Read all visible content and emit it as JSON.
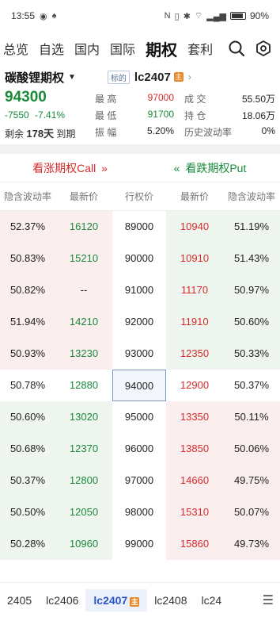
{
  "status": {
    "time": "13:55",
    "battery": "90%",
    "signal": "5G"
  },
  "nav": {
    "tabs": [
      "总览",
      "自选",
      "国内",
      "国际",
      "期权",
      "套利"
    ],
    "active_index": 4,
    "search_icon": "search-icon",
    "settings_icon": "hexagon-settings-icon"
  },
  "product": {
    "name": "碳酸锂期权",
    "underlying_tag": "标的",
    "contract": "lc2407",
    "main_badge": "主"
  },
  "quote": {
    "price": "94300",
    "change": "-7550",
    "change_pct": "-7.41%",
    "remain_prefix": "剩余",
    "remain_days": "178天",
    "remain_suffix": "到期",
    "high_label": "最 高",
    "high": "97000",
    "low_label": "最 低",
    "low": "91700",
    "amp_label": "振 幅",
    "amp": "5.20%",
    "volume_label": "成 交",
    "volume": "55.50万",
    "oi_label": "持 仓",
    "oi": "18.06万",
    "hv_label": "历史波动率",
    "hv": "0%"
  },
  "options": {
    "call_title": "看涨期权Call",
    "call_arrow": "»",
    "put_title": "看跌期权Put",
    "put_arrow": "«",
    "headers": [
      "隐含波动率",
      "最新价",
      "行权价",
      "最新价",
      "隐含波动率"
    ],
    "rows": [
      {
        "call_iv": "52.37%",
        "call_price": "16120",
        "strike": "89000",
        "put_price": "10940",
        "put_iv": "51.19%"
      },
      {
        "call_iv": "50.83%",
        "call_price": "15210",
        "strike": "90000",
        "put_price": "10910",
        "put_iv": "51.43%"
      },
      {
        "call_iv": "50.82%",
        "call_price": "--",
        "strike": "91000",
        "put_price": "11170",
        "put_iv": "50.97%"
      },
      {
        "call_iv": "51.94%",
        "call_price": "14210",
        "strike": "92000",
        "put_price": "11910",
        "put_iv": "50.60%"
      },
      {
        "call_iv": "50.93%",
        "call_price": "13230",
        "strike": "93000",
        "put_price": "12350",
        "put_iv": "50.33%"
      },
      {
        "call_iv": "50.78%",
        "call_price": "12880",
        "strike": "94000",
        "put_price": "12900",
        "put_iv": "50.37%"
      },
      {
        "call_iv": "50.60%",
        "call_price": "13020",
        "strike": "95000",
        "put_price": "13350",
        "put_iv": "50.11%"
      },
      {
        "call_iv": "50.68%",
        "call_price": "12370",
        "strike": "96000",
        "put_price": "13850",
        "put_iv": "50.06%"
      },
      {
        "call_iv": "50.37%",
        "call_price": "12800",
        "strike": "97000",
        "put_price": "14660",
        "put_iv": "49.75%"
      },
      {
        "call_iv": "50.50%",
        "call_price": "12050",
        "strike": "98000",
        "put_price": "15310",
        "put_iv": "50.07%"
      },
      {
        "call_iv": "50.28%",
        "call_price": "10960",
        "strike": "99000",
        "put_price": "15860",
        "put_iv": "49.73%"
      }
    ]
  },
  "bottom_tabs": {
    "items": [
      "2405",
      "lc2406",
      "lc2407",
      "lc2408",
      "lc24"
    ],
    "active_index": 2,
    "menu_icon": "menu-icon"
  }
}
